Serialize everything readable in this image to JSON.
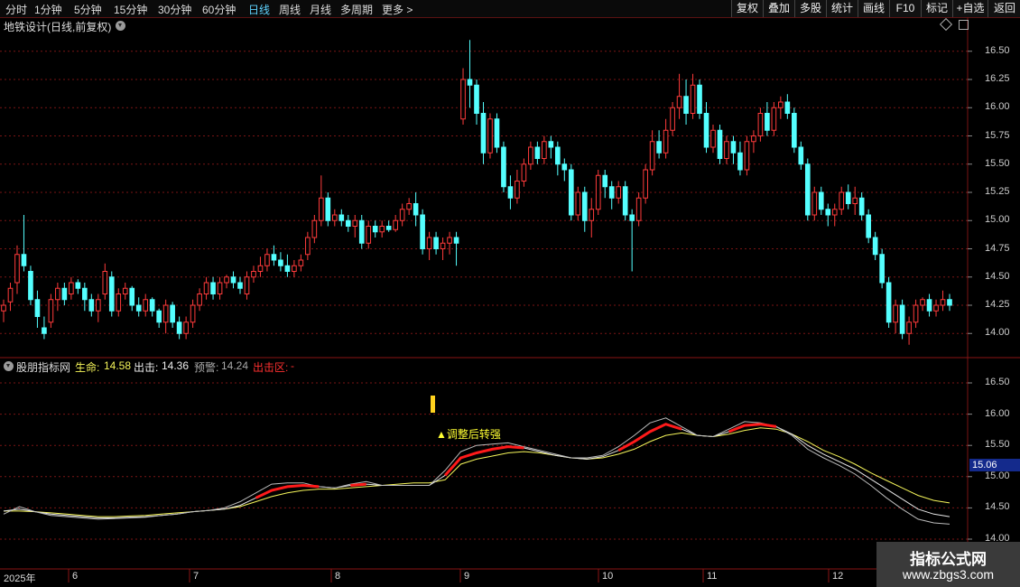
{
  "toolbar": {
    "periods": [
      "分时",
      "1分钟",
      "5分钟",
      "15分钟",
      "30分钟",
      "60分钟",
      "日线",
      "周线",
      "月线",
      "多周期",
      "更多 >"
    ],
    "active_period": "日线",
    "right_buttons": [
      "复权",
      "叠加",
      "多股",
      "统计",
      "画线",
      "F10",
      "标记",
      "+自选",
      "返回"
    ]
  },
  "main_panel": {
    "title": "地铁设计(日线,前复权)",
    "price_ticks": [
      "16.50",
      "16.25",
      "16.00",
      "15.75",
      "15.50",
      "15.25",
      "15.00",
      "14.75",
      "14.50",
      "14.25",
      "14.00"
    ]
  },
  "indicator_panel": {
    "name": "股朋指标网",
    "life_label": "生命:",
    "life_value": "14.58",
    "exit_label": "出击:",
    "exit_value": "14.36",
    "warn_label": "预警:",
    "warn_value": "14.24",
    "zone_label": "出击区:",
    "zone_value": "-",
    "signal_text": "▲调整后转强",
    "current_value_tag": "15.06",
    "ticks": [
      "16.50",
      "16.00",
      "15.50",
      "15.00",
      "14.50",
      "14.00"
    ]
  },
  "time_axis": {
    "labels": [
      "2025年",
      "6",
      "7",
      "8",
      "9",
      "10",
      "11",
      "12"
    ]
  },
  "watermark": {
    "title": "指标公式网",
    "url": "www.zbgs3.com"
  },
  "colors": {
    "up": "#ff3b3b",
    "down": "#54ffff",
    "life_line": "#f5f55a",
    "exit_line": "#e6e6e6",
    "warn_line": "#bbbbbb",
    "strong_line": "#ff1a1a",
    "grid": "#7a1515",
    "active_period": "#5fd3ff"
  },
  "chart_data": {
    "type": "candlestick",
    "title": "地铁设计(日线,前复权)",
    "y_range": [
      13.85,
      16.65
    ],
    "x_axis_months": [
      "2025年",
      "6",
      "7",
      "8",
      "9",
      "10",
      "11",
      "12"
    ],
    "ohlc": [
      [
        14.2,
        14.3,
        14.1,
        14.25
      ],
      [
        14.28,
        14.45,
        14.2,
        14.4
      ],
      [
        14.45,
        14.78,
        14.35,
        14.7
      ],
      [
        14.7,
        15.05,
        14.55,
        14.6
      ],
      [
        14.55,
        14.6,
        14.25,
        14.3
      ],
      [
        14.3,
        14.38,
        14.05,
        14.15
      ],
      [
        14.05,
        14.15,
        13.95,
        14.0
      ],
      [
        14.1,
        14.35,
        14.05,
        14.3
      ],
      [
        14.3,
        14.45,
        14.2,
        14.4
      ],
      [
        14.4,
        14.45,
        14.25,
        14.3
      ],
      [
        14.35,
        14.5,
        14.3,
        14.45
      ],
      [
        14.45,
        14.48,
        14.35,
        14.4
      ],
      [
        14.4,
        14.45,
        14.2,
        14.3
      ],
      [
        14.3,
        14.35,
        14.15,
        14.2
      ],
      [
        14.2,
        14.35,
        14.1,
        14.3
      ],
      [
        14.35,
        14.62,
        14.3,
        14.55
      ],
      [
        14.5,
        14.55,
        14.15,
        14.2
      ],
      [
        14.2,
        14.4,
        14.15,
        14.35
      ],
      [
        14.35,
        14.45,
        14.3,
        14.4
      ],
      [
        14.4,
        14.42,
        14.2,
        14.25
      ],
      [
        14.25,
        14.32,
        14.15,
        14.2
      ],
      [
        14.2,
        14.35,
        14.15,
        14.3
      ],
      [
        14.3,
        14.32,
        14.15,
        14.2
      ],
      [
        14.2,
        14.22,
        14.05,
        14.1
      ],
      [
        14.1,
        14.3,
        14.0,
        14.25
      ],
      [
        14.25,
        14.28,
        14.05,
        14.1
      ],
      [
        14.1,
        14.15,
        13.95,
        14.0
      ],
      [
        14.0,
        14.15,
        13.95,
        14.1
      ],
      [
        14.1,
        14.3,
        14.05,
        14.25
      ],
      [
        14.25,
        14.4,
        14.2,
        14.35
      ],
      [
        14.35,
        14.5,
        14.3,
        14.45
      ],
      [
        14.45,
        14.5,
        14.3,
        14.35
      ],
      [
        14.35,
        14.5,
        14.3,
        14.45
      ],
      [
        14.45,
        14.52,
        14.4,
        14.5
      ],
      [
        14.5,
        14.55,
        14.4,
        14.45
      ],
      [
        14.45,
        14.5,
        14.35,
        14.4
      ],
      [
        14.35,
        14.55,
        14.3,
        14.5
      ],
      [
        14.5,
        14.6,
        14.45,
        14.55
      ],
      [
        14.55,
        14.68,
        14.5,
        14.6
      ],
      [
        14.6,
        14.75,
        14.55,
        14.7
      ],
      [
        14.7,
        14.78,
        14.6,
        14.65
      ],
      [
        14.65,
        14.72,
        14.55,
        14.6
      ],
      [
        14.6,
        14.7,
        14.5,
        14.55
      ],
      [
        14.55,
        14.65,
        14.5,
        14.6
      ],
      [
        14.6,
        14.7,
        14.55,
        14.65
      ],
      [
        14.7,
        14.9,
        14.65,
        14.85
      ],
      [
        14.85,
        15.05,
        14.8,
        15.0
      ],
      [
        15.0,
        15.4,
        14.95,
        15.2
      ],
      [
        15.2,
        15.25,
        14.95,
        15.0
      ],
      [
        15.0,
        15.1,
        14.95,
        15.05
      ],
      [
        15.05,
        15.1,
        14.95,
        15.0
      ],
      [
        15.0,
        15.05,
        14.9,
        14.95
      ],
      [
        14.95,
        15.05,
        14.85,
        15.0
      ],
      [
        15.0,
        15.05,
        14.75,
        14.8
      ],
      [
        14.8,
        15.0,
        14.75,
        14.95
      ],
      [
        14.95,
        15.0,
        14.85,
        14.9
      ],
      [
        14.9,
        15.0,
        14.85,
        14.95
      ],
      [
        14.95,
        15.0,
        14.9,
        14.92
      ],
      [
        14.92,
        15.05,
        14.9,
        15.0
      ],
      [
        15.0,
        15.15,
        14.95,
        15.1
      ],
      [
        15.1,
        15.2,
        15.05,
        15.15
      ],
      [
        15.15,
        15.25,
        14.95,
        15.05
      ],
      [
        15.05,
        15.1,
        14.7,
        14.75
      ],
      [
        14.75,
        14.9,
        14.65,
        14.85
      ],
      [
        14.85,
        14.9,
        14.7,
        14.75
      ],
      [
        14.75,
        14.85,
        14.65,
        14.8
      ],
      [
        14.8,
        14.9,
        14.7,
        14.85
      ],
      [
        14.85,
        14.9,
        14.6,
        14.8
      ],
      [
        15.9,
        16.35,
        15.85,
        16.25
      ],
      [
        16.25,
        16.6,
        16.0,
        16.2
      ],
      [
        16.2,
        16.25,
        15.85,
        15.95
      ],
      [
        15.95,
        16.05,
        15.5,
        15.6
      ],
      [
        15.6,
        15.95,
        15.55,
        15.9
      ],
      [
        15.9,
        15.95,
        15.6,
        15.65
      ],
      [
        15.65,
        15.7,
        15.25,
        15.3
      ],
      [
        15.3,
        15.4,
        15.1,
        15.2
      ],
      [
        15.2,
        15.45,
        15.15,
        15.35
      ],
      [
        15.35,
        15.55,
        15.3,
        15.5
      ],
      [
        15.5,
        15.7,
        15.45,
        15.65
      ],
      [
        15.65,
        15.7,
        15.5,
        15.55
      ],
      [
        15.55,
        15.75,
        15.5,
        15.7
      ],
      [
        15.7,
        15.75,
        15.55,
        15.65
      ],
      [
        15.65,
        15.7,
        15.4,
        15.5
      ],
      [
        15.5,
        15.55,
        15.35,
        15.45
      ],
      [
        15.45,
        15.5,
        15.0,
        15.05
      ],
      [
        15.05,
        15.3,
        15.0,
        15.25
      ],
      [
        15.25,
        15.3,
        14.9,
        15.0
      ],
      [
        15.0,
        15.2,
        14.85,
        15.1
      ],
      [
        15.1,
        15.45,
        15.05,
        15.4
      ],
      [
        15.4,
        15.45,
        15.2,
        15.3
      ],
      [
        15.3,
        15.35,
        15.1,
        15.2
      ],
      [
        15.2,
        15.35,
        15.15,
        15.3
      ],
      [
        15.3,
        15.35,
        15.0,
        15.05
      ],
      [
        15.05,
        15.1,
        14.55,
        15.0
      ],
      [
        15.0,
        15.25,
        14.95,
        15.2
      ],
      [
        15.2,
        15.5,
        15.15,
        15.45
      ],
      [
        15.45,
        15.8,
        15.4,
        15.7
      ],
      [
        15.7,
        15.8,
        15.55,
        15.6
      ],
      [
        15.6,
        15.9,
        15.55,
        15.8
      ],
      [
        15.8,
        16.05,
        15.75,
        16.0
      ],
      [
        16.0,
        16.3,
        15.9,
        16.1
      ],
      [
        16.1,
        16.25,
        15.85,
        15.95
      ],
      [
        15.95,
        16.3,
        15.9,
        16.2
      ],
      [
        16.2,
        16.25,
        15.9,
        15.95
      ],
      [
        15.95,
        16.05,
        15.6,
        15.65
      ],
      [
        15.65,
        15.85,
        15.6,
        15.8
      ],
      [
        15.8,
        15.85,
        15.5,
        15.55
      ],
      [
        15.55,
        15.75,
        15.5,
        15.7
      ],
      [
        15.7,
        15.75,
        15.5,
        15.6
      ],
      [
        15.6,
        15.7,
        15.4,
        15.45
      ],
      [
        15.45,
        15.75,
        15.4,
        15.7
      ],
      [
        15.7,
        15.8,
        15.6,
        15.75
      ],
      [
        15.75,
        16.0,
        15.7,
        15.95
      ],
      [
        15.95,
        16.05,
        15.75,
        15.8
      ],
      [
        15.8,
        16.05,
        15.75,
        16.0
      ],
      [
        16.0,
        16.1,
        15.9,
        16.05
      ],
      [
        16.05,
        16.12,
        15.9,
        15.95
      ],
      [
        15.95,
        16.0,
        15.6,
        15.65
      ],
      [
        15.65,
        15.7,
        15.45,
        15.5
      ],
      [
        15.5,
        15.55,
        15.0,
        15.05
      ],
      [
        15.05,
        15.3,
        15.0,
        15.25
      ],
      [
        15.25,
        15.3,
        15.05,
        15.1
      ],
      [
        15.1,
        15.15,
        14.95,
        15.05
      ],
      [
        15.05,
        15.15,
        14.95,
        15.1
      ],
      [
        15.1,
        15.3,
        15.05,
        15.25
      ],
      [
        15.25,
        15.32,
        15.1,
        15.15
      ],
      [
        15.15,
        15.3,
        15.05,
        15.2
      ],
      [
        15.2,
        15.25,
        15.0,
        15.05
      ],
      [
        15.05,
        15.1,
        14.8,
        14.85
      ],
      [
        14.85,
        14.9,
        14.65,
        14.7
      ],
      [
        14.7,
        14.75,
        14.4,
        14.45
      ],
      [
        14.45,
        14.5,
        14.05,
        14.1
      ],
      [
        14.1,
        14.3,
        14.0,
        14.25
      ],
      [
        14.25,
        14.3,
        13.95,
        14.0
      ],
      [
        14.0,
        14.15,
        13.9,
        14.1
      ],
      [
        14.1,
        14.3,
        14.05,
        14.25
      ],
      [
        14.25,
        14.32,
        14.2,
        14.3
      ],
      [
        14.3,
        14.35,
        14.15,
        14.2
      ],
      [
        14.2,
        14.3,
        14.15,
        14.25
      ],
      [
        14.25,
        14.38,
        14.2,
        14.3
      ],
      [
        14.3,
        14.35,
        14.2,
        14.25
      ]
    ],
    "indicator": {
      "y_range": [
        14.0,
        16.5
      ],
      "series": [
        {
          "name": "生命",
          "color": "#f5f55a",
          "values": [
            14.45,
            14.45,
            14.44,
            14.42,
            14.4,
            14.38,
            14.36,
            14.36,
            14.37,
            14.38,
            14.4,
            14.42,
            14.44,
            14.46,
            14.48,
            14.52,
            14.6,
            14.68,
            14.74,
            14.78,
            14.8,
            14.8,
            14.82,
            14.84,
            14.86,
            14.88,
            14.9,
            14.9,
            14.95,
            15.2,
            15.28,
            15.33,
            15.38,
            15.4,
            15.38,
            15.34,
            15.3,
            15.28,
            15.3,
            15.36,
            15.44,
            15.56,
            15.66,
            15.7,
            15.66,
            15.64,
            15.68,
            15.74,
            15.78,
            15.76,
            15.68,
            15.56,
            15.42,
            15.32,
            15.2,
            15.06,
            14.94,
            14.82,
            14.7,
            14.62,
            14.58
          ]
        },
        {
          "name": "出击",
          "color": "#e6e6e6",
          "values": [
            14.45,
            14.48,
            14.44,
            14.4,
            14.38,
            14.36,
            14.34,
            14.34,
            14.35,
            14.36,
            14.38,
            14.4,
            14.44,
            14.46,
            14.48,
            14.54,
            14.66,
            14.78,
            14.84,
            14.86,
            14.84,
            14.82,
            14.86,
            14.88,
            14.86,
            14.86,
            14.86,
            14.86,
            15.02,
            15.3,
            15.38,
            15.44,
            15.48,
            15.46,
            15.4,
            15.34,
            15.3,
            15.28,
            15.32,
            15.42,
            15.56,
            15.72,
            15.84,
            15.76,
            15.66,
            15.64,
            15.72,
            15.82,
            15.84,
            15.8,
            15.68,
            15.5,
            15.36,
            15.24,
            15.12,
            14.96,
            14.8,
            14.64,
            14.48,
            14.4,
            14.36
          ]
        },
        {
          "name": "预警",
          "color": "#bbbbbb",
          "values": [
            14.4,
            14.52,
            14.44,
            14.38,
            14.36,
            14.34,
            14.32,
            14.33,
            14.34,
            14.35,
            14.38,
            14.4,
            14.44,
            14.46,
            14.5,
            14.6,
            14.74,
            14.88,
            14.9,
            14.9,
            14.84,
            14.82,
            14.88,
            14.92,
            14.86,
            14.86,
            14.86,
            14.86,
            15.1,
            15.4,
            15.5,
            15.52,
            15.54,
            15.48,
            15.42,
            15.36,
            15.3,
            15.3,
            15.34,
            15.48,
            15.66,
            15.86,
            15.94,
            15.8,
            15.66,
            15.64,
            15.76,
            15.88,
            15.86,
            15.8,
            15.66,
            15.44,
            15.3,
            15.18,
            15.04,
            14.86,
            14.66,
            14.48,
            14.32,
            14.26,
            14.24
          ]
        }
      ]
    }
  }
}
